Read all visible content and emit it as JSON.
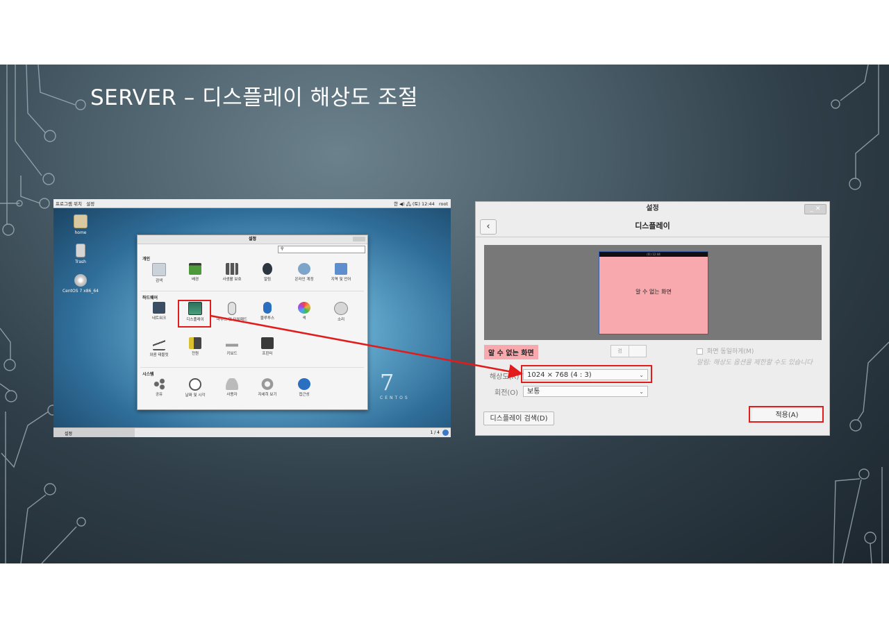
{
  "slide": {
    "title": "SERVER – 디스플레이 해상도 조절"
  },
  "desktop": {
    "topbar": {
      "menu": "프로그램  위치",
      "app": "설정",
      "status": "한  ◀) 🖧 (토) 12:44",
      "user": "root"
    },
    "icons": [
      {
        "label": "home"
      },
      {
        "label": "Trash"
      },
      {
        "label": "CentOS 7 x86_64"
      }
    ],
    "taskbar": {
      "task": "설정",
      "page": "1 / 4"
    },
    "brand_number": "7",
    "brand_word": "CENTOS",
    "settings_window": {
      "title": "설정",
      "sections": [
        {
          "title": "개인",
          "items": [
            "검색",
            "배경",
            "사생활 보호",
            "알림",
            "온라인 계정",
            "지역 및 언어"
          ]
        },
        {
          "title": "하드웨어",
          "items": [
            "네트워크",
            "디스플레이",
            "마우스 및 터치패드",
            "블루투스",
            "색",
            "소리",
            "와콤 태블릿",
            "전원",
            "키보드",
            "프린터"
          ]
        },
        {
          "title": "시스템",
          "items": [
            "공유",
            "날짜 및 시각",
            "사용자",
            "자세히 보기",
            "접근성"
          ]
        }
      ]
    }
  },
  "dialog": {
    "window_title": "설정",
    "header_title": "디스플레이",
    "monitor_label": "알 수 없는 화면",
    "monitor_time": "(토) 12:44",
    "display_name": "알 수 없는 화면",
    "toggle_on": "켬",
    "mirror_label": "화면 동일하게(M)",
    "note": "알림: 해상도 옵션을 제한할 수도 있습니다",
    "resolution_label": "해상도(R)",
    "resolution_value": "1024 × 768 (4 : 3)",
    "rotation_label": "회전(O)",
    "rotation_value": "보통",
    "detect_button": "디스플레이 검색(D)",
    "apply_button": "적용(A)"
  },
  "colors": {
    "highlight": "#e21b1b",
    "monitor_pink": "#f8a9ae"
  }
}
